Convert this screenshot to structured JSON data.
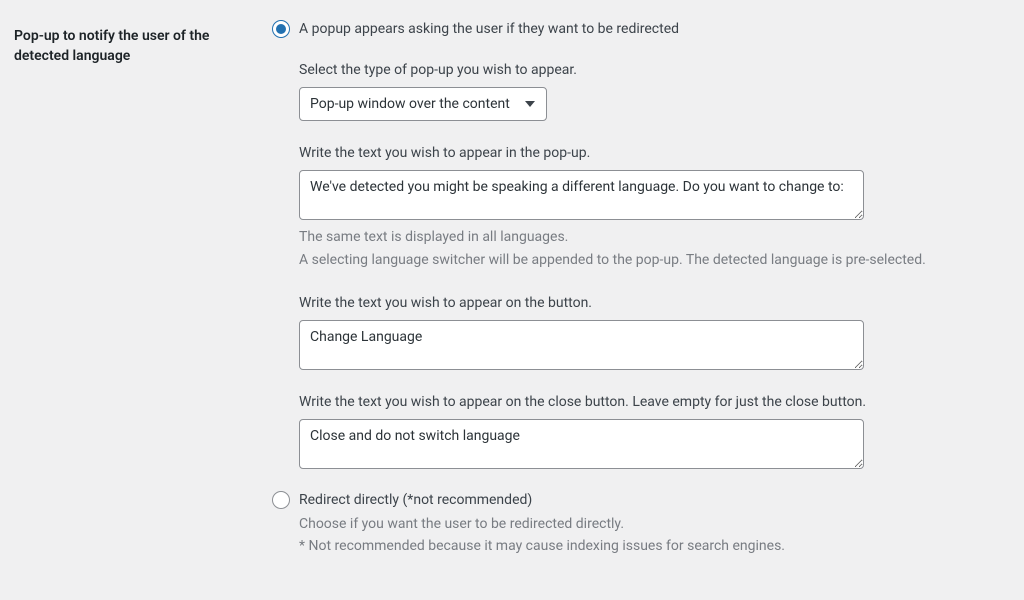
{
  "section_title": "Pop-up to notify the user of the detected language",
  "option_popup": {
    "label": "A popup appears asking the user if they want to be redirected",
    "popup_type_label": "Select the type of pop-up you wish to appear.",
    "popup_type_selected": "Pop-up window over the content",
    "popup_text_label": "Write the text you wish to appear in the pop-up.",
    "popup_text_value": "We've detected you might be speaking a different language. Do you want to change to:",
    "popup_text_help1": "The same text is displayed in all languages.",
    "popup_text_help2": "A selecting language switcher will be appended to the pop-up. The detected language is pre-selected.",
    "button_text_label": "Write the text you wish to appear on the button.",
    "button_text_value": "Change Language",
    "close_text_label": "Write the text you wish to appear on the close button. Leave empty for just the close button.",
    "close_text_value": "Close and do not switch language"
  },
  "option_redirect": {
    "label": "Redirect directly (*not recommended)",
    "desc1": "Choose if you want the user to be redirected directly.",
    "desc2": "* Not recommended because it may cause indexing issues for search engines."
  }
}
